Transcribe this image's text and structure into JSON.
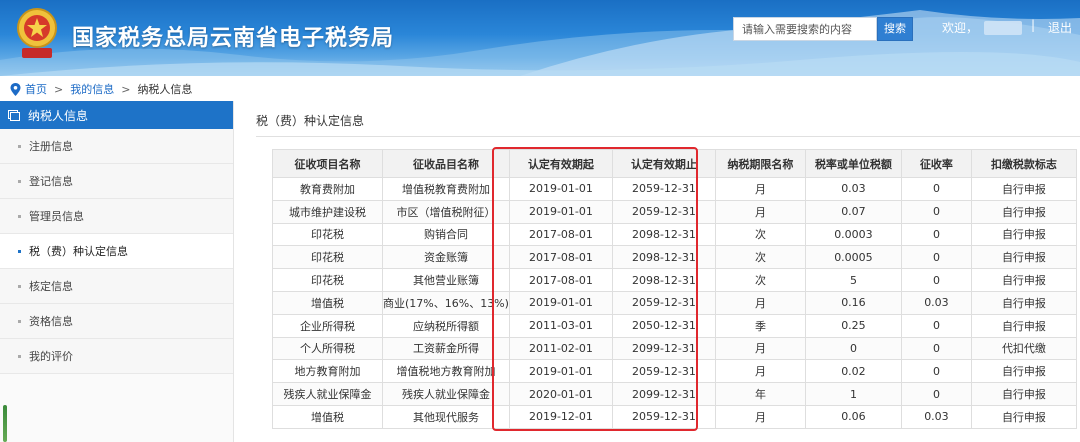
{
  "header": {
    "title": "国家税务总局云南省电子税务局",
    "emblem_text": "中国税务",
    "search_placeholder": "请输入需要搜索的内容",
    "search_button": "搜索",
    "welcome": "欢迎，",
    "separator": "|",
    "logout": "退出"
  },
  "breadcrumb": {
    "home": "首页",
    "separator": ">",
    "level2": "我的信息",
    "current": "纳税人信息"
  },
  "sidebar": {
    "header": "纳税人信息",
    "items": [
      {
        "label": "注册信息"
      },
      {
        "label": "登记信息"
      },
      {
        "label": "管理员信息"
      },
      {
        "label": "税（费）种认定信息"
      },
      {
        "label": "核定信息"
      },
      {
        "label": "资格信息"
      },
      {
        "label": "我的评价"
      }
    ],
    "active_index": 3
  },
  "main": {
    "section_title": "税（费）种认定信息",
    "columns": [
      "征收项目名称",
      "征收品目名称",
      "认定有效期起",
      "认定有效期止",
      "纳税期限名称",
      "税率或单位税额",
      "征收率",
      "扣缴税款标志"
    ],
    "rows": [
      [
        "教育费附加",
        "增值税教育费附加",
        "2019-01-01",
        "2059-12-31",
        "月",
        "0.03",
        "0",
        "自行申报"
      ],
      [
        "城市维护建设税",
        "市区（增值税附征）",
        "2019-01-01",
        "2059-12-31",
        "月",
        "0.07",
        "0",
        "自行申报"
      ],
      [
        "印花税",
        "购销合同",
        "2017-08-01",
        "2098-12-31",
        "次",
        "0.0003",
        "0",
        "自行申报"
      ],
      [
        "印花税",
        "资金账簿",
        "2017-08-01",
        "2098-12-31",
        "次",
        "0.0005",
        "0",
        "自行申报"
      ],
      [
        "印花税",
        "其他营业账簿",
        "2017-08-01",
        "2098-12-31",
        "次",
        "5",
        "0",
        "自行申报"
      ],
      [
        "增值税",
        "商业(17%、16%、13%)",
        "2019-01-01",
        "2059-12-31",
        "月",
        "0.16",
        "0.03",
        "自行申报"
      ],
      [
        "企业所得税",
        "应纳税所得额",
        "2011-03-01",
        "2050-12-31",
        "季",
        "0.25",
        "0",
        "自行申报"
      ],
      [
        "个人所得税",
        "工资薪金所得",
        "2011-02-01",
        "2099-12-31",
        "月",
        "0",
        "0",
        "代扣代缴"
      ],
      [
        "地方教育附加",
        "增值税地方教育附加",
        "2019-01-01",
        "2059-12-31",
        "月",
        "0.02",
        "0",
        "自行申报"
      ],
      [
        "残疾人就业保障金",
        "残疾人就业保障金",
        "2020-01-01",
        "2099-12-31",
        "年",
        "1",
        "0",
        "自行申报"
      ],
      [
        "增值税",
        "其他现代服务",
        "2019-12-01",
        "2059-12-31",
        "月",
        "0.06",
        "0.03",
        "自行申报"
      ]
    ]
  },
  "colors": {
    "header_blue": "#1a6fc4",
    "sidebar_active": "#1e73c8",
    "link_blue": "#1d6bc6",
    "highlight_red": "#e0282e"
  }
}
